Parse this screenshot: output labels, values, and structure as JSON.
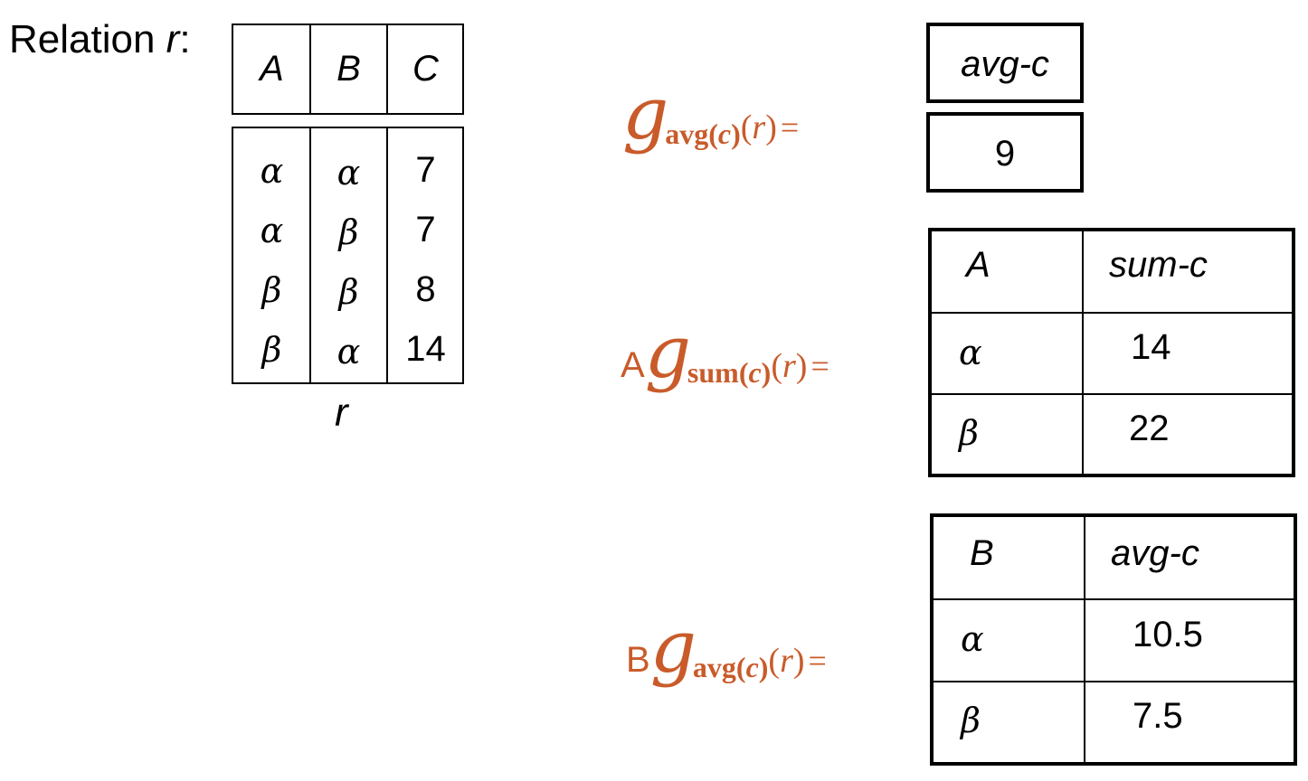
{
  "relation_label": {
    "prefix": "Relation ",
    "name": "r",
    "suffix": ":"
  },
  "relation_r": {
    "headers": [
      "A",
      "B",
      "C"
    ],
    "rows": [
      [
        "α",
        "α",
        "7"
      ],
      [
        "α",
        "β",
        "7"
      ],
      [
        "β",
        "β",
        "8"
      ],
      [
        "β",
        "α",
        "14"
      ]
    ],
    "caption": "r"
  },
  "formula1": {
    "prefix": "",
    "g": "g",
    "sub": "avg(",
    "sub_var": "c",
    "sub_close": ")",
    "arg_open": "(",
    "arg_var": "r",
    "arg_close": ")",
    "eq": "="
  },
  "formula2": {
    "prefix": "A",
    "g": "g",
    "sub": "sum(",
    "sub_var": "c",
    "sub_close": ")",
    "arg_open": "(",
    "arg_var": "r",
    "arg_close": ")",
    "eq": "="
  },
  "formula3": {
    "prefix": "B",
    "g": "g",
    "sub": "avg(",
    "sub_var": "c",
    "sub_close": ")",
    "arg_open": "(",
    "arg_var": "r",
    "arg_close": ")",
    "eq": "="
  },
  "result1": {
    "header": "avg-c",
    "value": "9"
  },
  "result2": {
    "headers": [
      "A",
      "sum-c"
    ],
    "rows": [
      [
        "α",
        "14"
      ],
      [
        "β",
        "22"
      ]
    ]
  },
  "result3": {
    "headers": [
      "B",
      "avg-c"
    ],
    "rows": [
      [
        "α",
        "10.5"
      ],
      [
        "β",
        "7.5"
      ]
    ]
  },
  "colors": {
    "formula": "#c95b2a",
    "lines": "#000000"
  }
}
